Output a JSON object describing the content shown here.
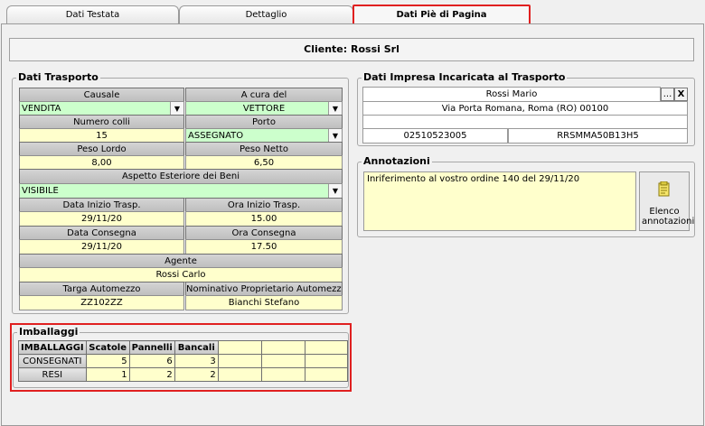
{
  "tabs": [
    {
      "label": "Dati Testata"
    },
    {
      "label": "Dettaglio"
    },
    {
      "label": "Dati Piè di Pagina"
    }
  ],
  "client": "Cliente: Rossi Srl",
  "transport": {
    "title": "Dati Trasporto",
    "causale": {
      "label": "Causale",
      "value": "VENDITA"
    },
    "a_cura": {
      "label": "A cura del",
      "value": "VETTORE"
    },
    "numero_colli": {
      "label": "Numero colli",
      "value": "15"
    },
    "porto": {
      "label": "Porto",
      "value": "ASSEGNATO"
    },
    "peso_lordo": {
      "label": "Peso Lordo",
      "value": "8,00"
    },
    "peso_netto": {
      "label": "Peso Netto",
      "value": "6,50"
    },
    "aspetto": {
      "label": "Aspetto Esteriore dei Beni",
      "value": "VISIBILE"
    },
    "data_inizio": {
      "label": "Data Inizio Trasp.",
      "value": "29/11/20"
    },
    "ora_inizio": {
      "label": "Ora Inizio Trasp.",
      "value": "15.00"
    },
    "data_consegna": {
      "label": "Data Consegna",
      "value": "29/11/20"
    },
    "ora_consegna": {
      "label": "Ora Consegna",
      "value": "17.50"
    },
    "agente": {
      "label": "Agente",
      "value": "Rossi Carlo"
    },
    "targa": {
      "label": "Targa Automezzo",
      "value": "ZZ102ZZ"
    },
    "proprietario": {
      "label": "Nominativo Proprietario Automezzo",
      "value": "Bianchi Stefano"
    }
  },
  "carrier": {
    "title": "Dati Impresa Incaricata al Trasporto",
    "name": "Rossi Mario",
    "address": "Via Porta Romana, Roma (RO) 00100",
    "piva": "02510523005",
    "cf": "RRSMMA50B13H5",
    "browse_label": "...",
    "clear_label": "X"
  },
  "annotations": {
    "title": "Annotazioni",
    "text": "Inriferimento al vostro ordine 140 del 29/11/20",
    "button_label": "Elenco annotazioni"
  },
  "packaging": {
    "title": "Imballaggi",
    "header": [
      "IMBALLAGGI",
      "Scatole",
      "Pannelli",
      "Bancali",
      "",
      "",
      ""
    ],
    "rows": [
      {
        "label": "CONSEGNATI",
        "values": [
          "5",
          "6",
          "3",
          "",
          "",
          ""
        ]
      },
      {
        "label": "RESI",
        "values": [
          "1",
          "2",
          "2",
          "",
          "",
          ""
        ]
      }
    ]
  }
}
